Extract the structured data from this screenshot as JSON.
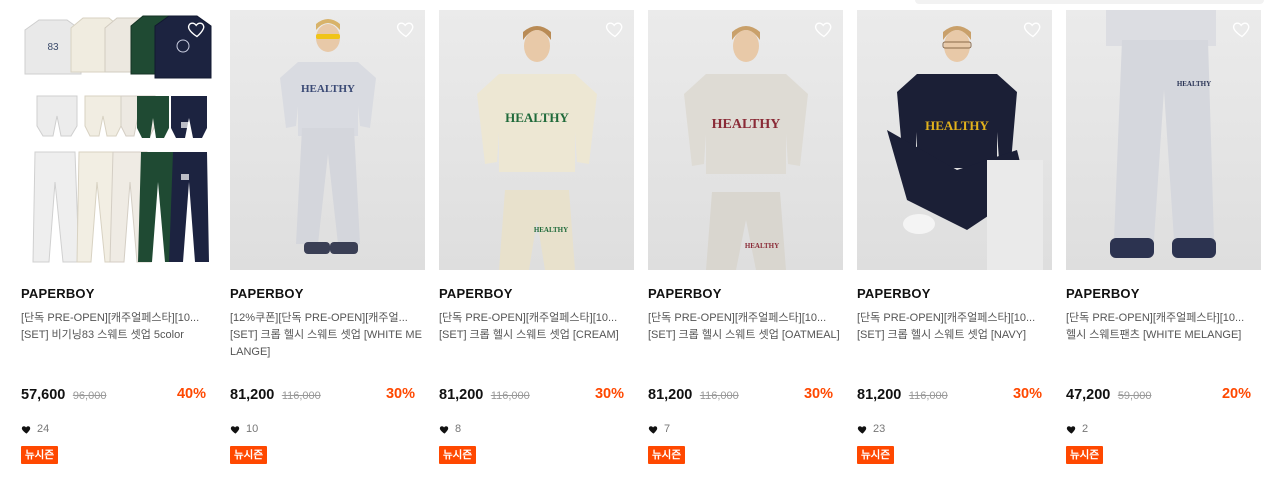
{
  "colors": {
    "accent": "#ff4800",
    "text": "#111111",
    "muted": "#777777"
  },
  "products": [
    {
      "brand": "PAPERBOY",
      "title1": "[단독 PRE-OPEN][캐주얼페스타][10...",
      "title2": "[SET] 비기닝83 스웨트 셋업 5color",
      "price": "57,600",
      "original_price": "96,000",
      "discount": "40%",
      "likes": "24",
      "badge": "뉴시즌",
      "image_icon": "product-grid-image"
    },
    {
      "brand": "PAPERBOY",
      "title1": "[12%쿠폰][단독 PRE-OPEN][캐주얼...",
      "title2": "[SET] 크롭 헬시 스웨트 셋업 [WHITE MELANGE]",
      "price": "81,200",
      "original_price": "116,000",
      "discount": "30%",
      "likes": "10",
      "badge": "뉴시즌",
      "image_icon": "model-photo"
    },
    {
      "brand": "PAPERBOY",
      "title1": "[단독 PRE-OPEN][캐주얼페스타][10...",
      "title2": "[SET] 크롭 헬시 스웨트 셋업 [CREAM]",
      "price": "81,200",
      "original_price": "116,000",
      "discount": "30%",
      "likes": "8",
      "badge": "뉴시즌",
      "image_icon": "model-photo"
    },
    {
      "brand": "PAPERBOY",
      "title1": "[단독 PRE-OPEN][캐주얼페스타][10...",
      "title2": "[SET] 크롭 헬시 스웨트 셋업 [OATMEAL]",
      "price": "81,200",
      "original_price": "116,000",
      "discount": "30%",
      "likes": "7",
      "badge": "뉴시즌",
      "image_icon": "model-photo"
    },
    {
      "brand": "PAPERBOY",
      "title1": "[단독 PRE-OPEN][캐주얼페스타][10...",
      "title2": "[SET] 크롭 헬시 스웨트 셋업 [NAVY]",
      "price": "81,200",
      "original_price": "116,000",
      "discount": "30%",
      "likes": "23",
      "badge": "뉴시즌",
      "image_icon": "model-photo"
    },
    {
      "brand": "PAPERBOY",
      "title1": "[단독 PRE-OPEN][캐주얼페스타][10...",
      "title2": "헬시 스웨트팬츠 [WHITE MELANGE]",
      "price": "47,200",
      "original_price": "59,000",
      "discount": "20%",
      "likes": "2",
      "badge": "뉴시즌",
      "image_icon": "model-photo"
    }
  ]
}
